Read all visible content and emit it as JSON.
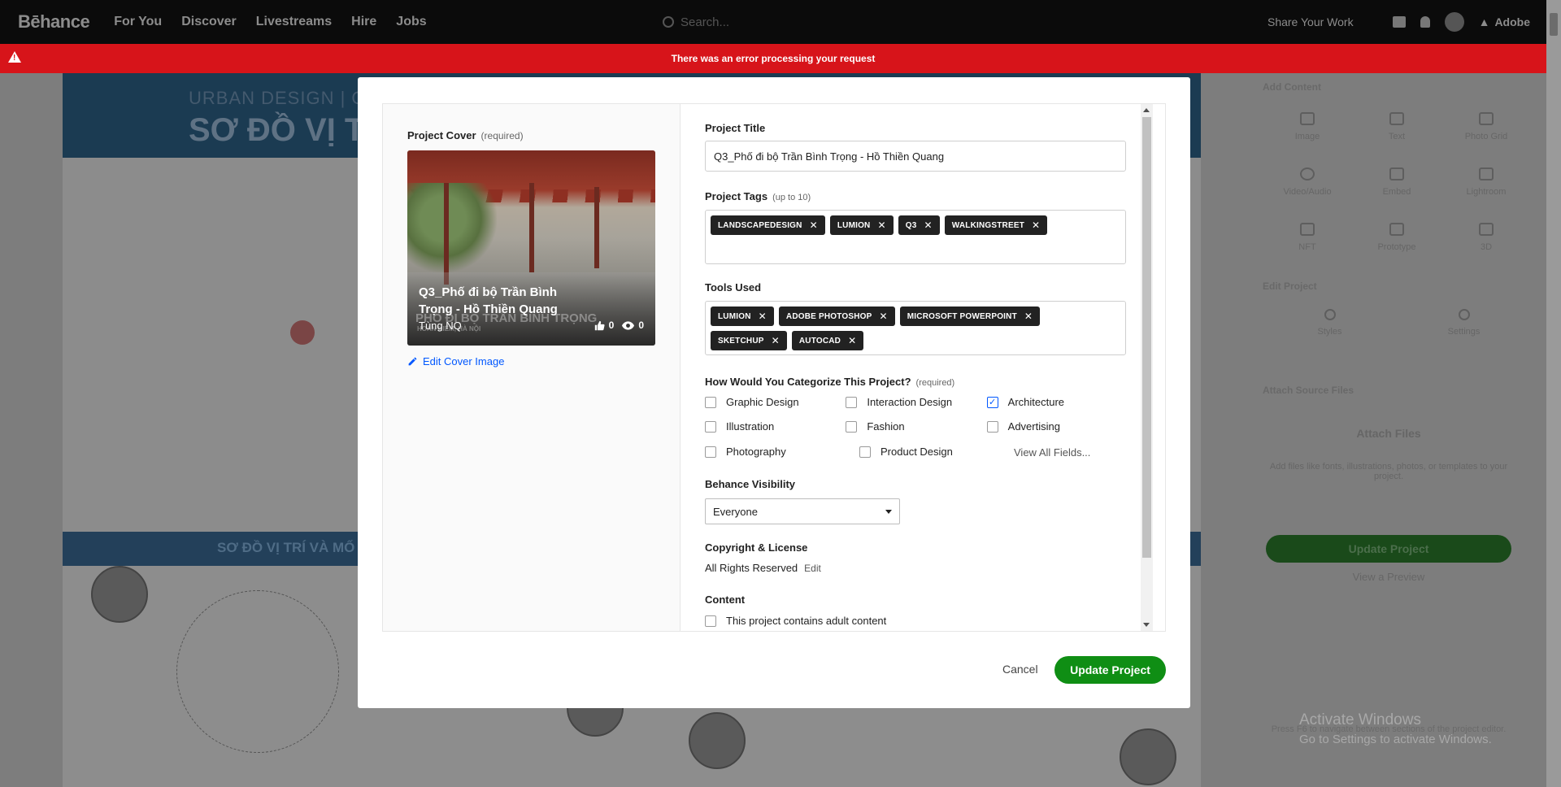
{
  "nav": {
    "logo": "Bēhance",
    "links": [
      "For You",
      "Discover",
      "Livestreams",
      "Hire",
      "Jobs"
    ],
    "search_placeholder": "Search...",
    "share": "Share Your Work",
    "adobe": "Adobe"
  },
  "error_banner": {
    "text": "There was an error processing your request",
    "color": "#d7141a"
  },
  "background_project": {
    "banner_small": "URBAN DESIGN | Q3",
    "banner_large": "SƠ ĐỒ VỊ T",
    "strip": "SƠ ĐỒ VỊ TRÍ VÀ MỐ"
  },
  "side_panel": {
    "add_content": "Add Content",
    "tools": [
      [
        "Image",
        "Text",
        "Photo Grid"
      ],
      [
        "Video/Audio",
        "Embed",
        "Lightroom"
      ],
      [
        "NFT",
        "Prototype",
        "3D"
      ]
    ],
    "edit_project": "Edit Project",
    "edit_tools": [
      "Styles",
      "Settings"
    ],
    "attach_source": "Attach Source Files",
    "attach_files": "Attach Files",
    "attach_desc": "Add files like fonts, illustrations, photos, or templates to your project.",
    "update_btn": "Update Project",
    "preview": "View a Preview",
    "hint": "Press F6 to navigate between sections of the project editor."
  },
  "modal": {
    "cover": {
      "label": "Project Cover",
      "required": "(required)",
      "title": "Q3_Phố đi bộ Trần Bình Trọng - Hồ Thiền Quang",
      "owner": "Tùng NQ",
      "ghost_title": "PHỐ ĐI BỘ TRẦN BÌNH TRỌNG",
      "ghost_sub": "HOÀN KIẾM, HÀ NỘI",
      "likes": "0",
      "views": "0",
      "edit": "Edit Cover Image"
    },
    "title_label": "Project Title",
    "title_value": "Q3_Phố đi bộ Trần Bình Trọng - Hồ Thiền Quang",
    "tags_label": "Project Tags",
    "tags_hint": "(up to 10)",
    "tags": [
      "LANDSCAPEDESIGN",
      "LUMION",
      "Q3",
      "WALKINGSTREET"
    ],
    "tools_label": "Tools Used",
    "tools": [
      "LUMION",
      "ADOBE PHOTOSHOP",
      "MICROSOFT POWERPOINT",
      "SKETCHUP",
      "AUTOCAD"
    ],
    "category_label": "How Would You Categorize This Project?",
    "category_required": "(required)",
    "categories": [
      [
        {
          "label": "Graphic Design",
          "checked": false
        },
        {
          "label": "Interaction Design",
          "checked": false
        },
        {
          "label": "Architecture",
          "checked": true
        }
      ],
      [
        {
          "label": "Illustration",
          "checked": false
        },
        {
          "label": "Fashion",
          "checked": false
        },
        {
          "label": "Advertising",
          "checked": false
        }
      ],
      [
        {
          "label": "Photography",
          "checked": false
        },
        {
          "label": "Product Design",
          "checked": false
        }
      ]
    ],
    "view_all": "View All Fields...",
    "visibility_label": "Behance Visibility",
    "visibility_value": "Everyone",
    "copyright_label": "Copyright & License",
    "copyright_value": "All Rights Reserved",
    "copyright_edit": "Edit",
    "content_label": "Content",
    "adult_content": "This project contains adult content",
    "cancel": "Cancel",
    "update": "Update Project",
    "accent": "#0f8e14"
  },
  "activate": {
    "line1": "Activate Windows",
    "line2": "Go to Settings to activate Windows."
  }
}
